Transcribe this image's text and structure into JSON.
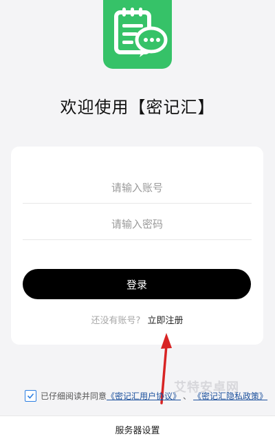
{
  "app": {
    "welcome_title": "欢迎使用【密记汇】",
    "accent_color": "#36c268",
    "logo_icon": "notepad-chat-icon"
  },
  "login_form": {
    "account_placeholder": "请输入账号",
    "password_placeholder": "请输入密码",
    "login_label": "登录",
    "no_account_hint": "还没有账号?",
    "register_label": "立即注册"
  },
  "agreement": {
    "checked": true,
    "prefix": "已仔细阅读并同意",
    "user_agreement": "《密记汇用户协议》",
    "separator": "、",
    "privacy_policy": "《密记汇隐私政策》"
  },
  "footer": {
    "server_settings_label": "服务器设置"
  },
  "watermark": "艾特安卓网"
}
